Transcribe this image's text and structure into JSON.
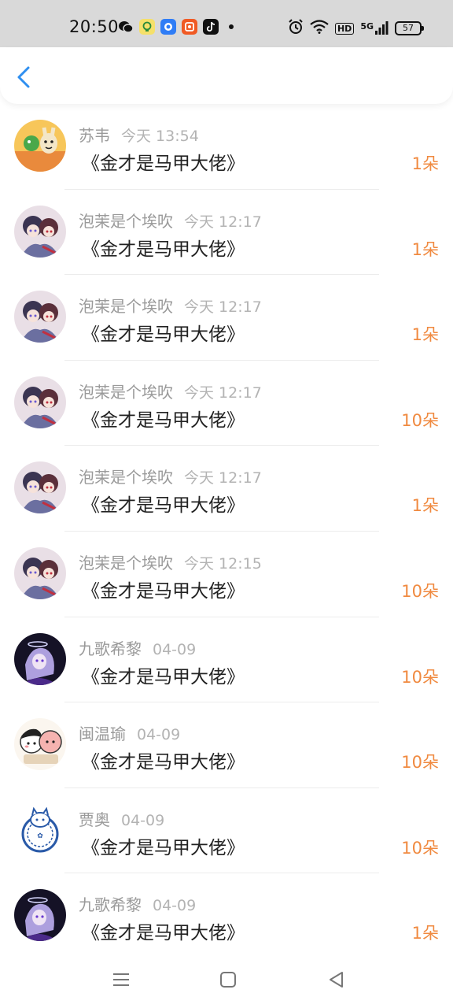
{
  "status_bar": {
    "time": "20:50",
    "apps": [
      "wechat-icon",
      "app-icon",
      "app-icon",
      "app-icon",
      "tiktok-icon"
    ],
    "hd": "HD",
    "network": "5G",
    "battery": "57"
  },
  "rows": [
    {
      "name": "苏韦",
      "time": "今天 13:54",
      "book": "《金才是马甲大佬》",
      "amount": "1朵",
      "avatar": "avatar-cartoon-rabbit"
    },
    {
      "name": "泡茉是个埃吹",
      "time": "今天 12:17",
      "book": "《金才是马甲大佬》",
      "amount": "1朵",
      "avatar": "avatar-anime-pair"
    },
    {
      "name": "泡茉是个埃吹",
      "time": "今天 12:17",
      "book": "《金才是马甲大佬》",
      "amount": "1朵",
      "avatar": "avatar-anime-pair"
    },
    {
      "name": "泡茉是个埃吹",
      "time": "今天 12:17",
      "book": "《金才是马甲大佬》",
      "amount": "10朵",
      "avatar": "avatar-anime-pair"
    },
    {
      "name": "泡茉是个埃吹",
      "time": "今天 12:17",
      "book": "《金才是马甲大佬》",
      "amount": "1朵",
      "avatar": "avatar-anime-pair"
    },
    {
      "name": "泡茉是个埃吹",
      "time": "今天 12:15",
      "book": "《金才是马甲大佬》",
      "amount": "10朵",
      "avatar": "avatar-anime-pair"
    },
    {
      "name": "九歌希黎",
      "time": "04-09",
      "book": "《金才是马甲大佬》",
      "amount": "10朵",
      "avatar": "avatar-dark-anime"
    },
    {
      "name": "闽温瑜",
      "time": "04-09",
      "book": "《金才是马甲大佬》",
      "amount": "10朵",
      "avatar": "avatar-cartoon-couple"
    },
    {
      "name": "贾奥",
      "time": "04-09",
      "book": "《金才是马甲大佬》",
      "amount": "10朵",
      "avatar": "avatar-blue-cat"
    },
    {
      "name": "九歌希黎",
      "time": "04-09",
      "book": "《金才是马甲大佬》",
      "amount": "1朵",
      "avatar": "avatar-dark-anime"
    }
  ],
  "colors": {
    "accent": "#2f8ff0",
    "amount": "#f08a40",
    "name": "#9a9a9a"
  }
}
